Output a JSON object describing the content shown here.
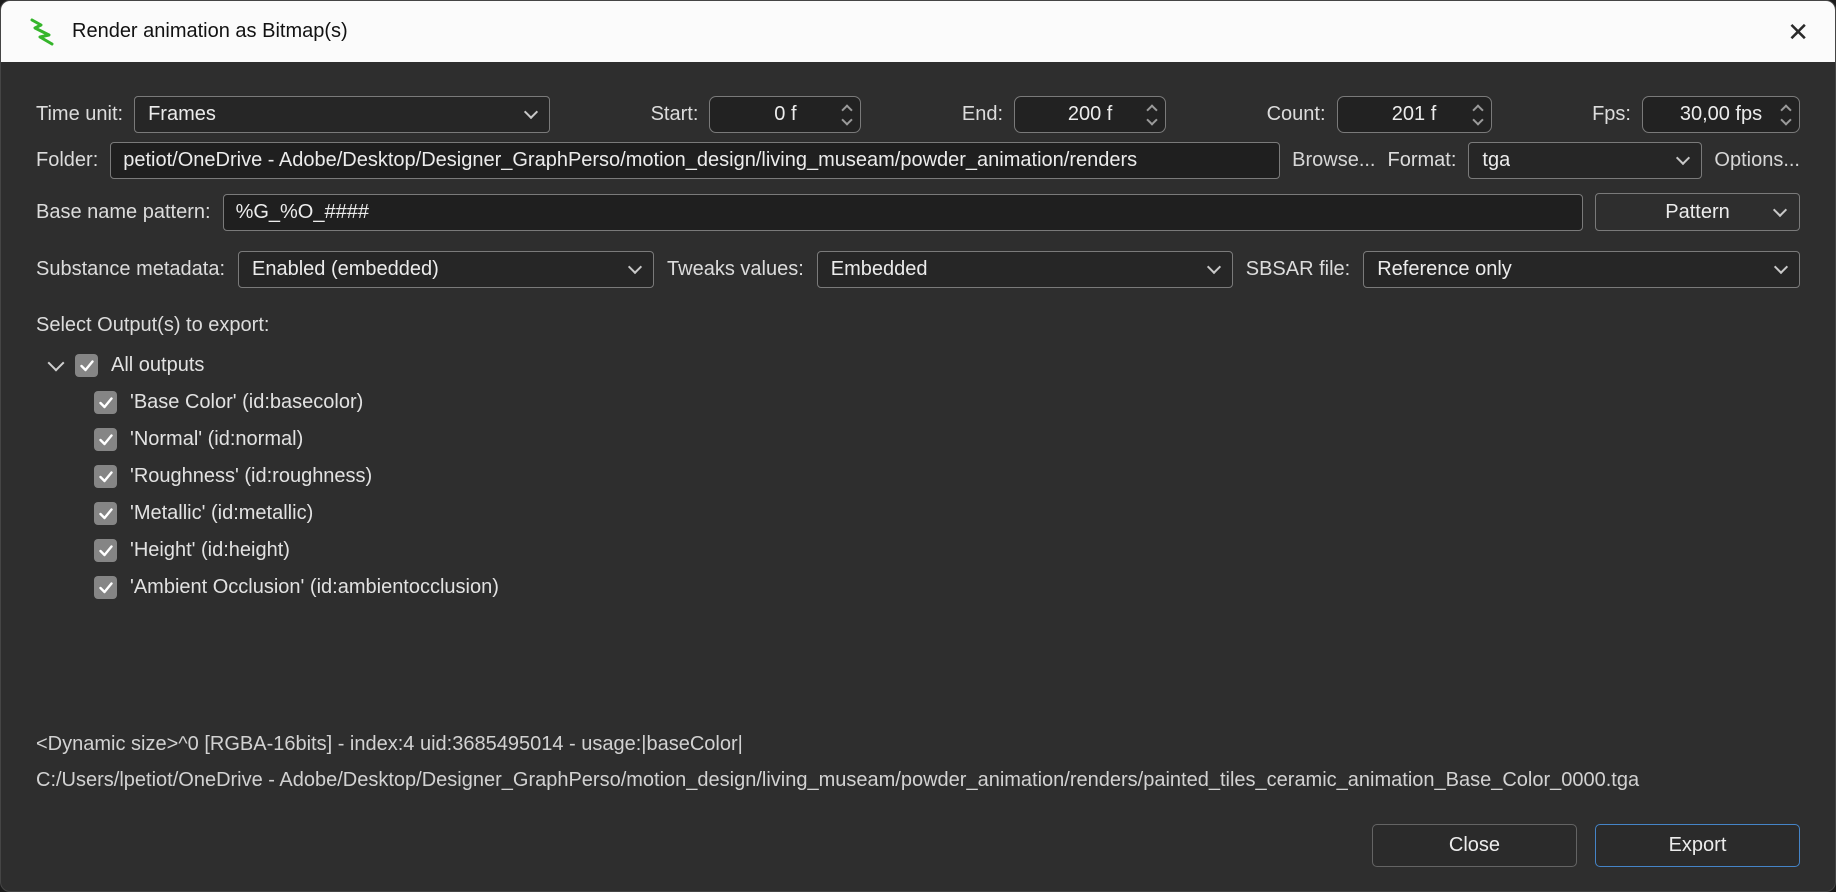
{
  "window": {
    "title": "Render animation as Bitmap(s)",
    "close_glyph": "✕"
  },
  "row1": {
    "time_unit_label": "Time unit:",
    "time_unit_value": "Frames",
    "start_label": "Start:",
    "start_value": "0 f",
    "end_label": "End:",
    "end_value": "200 f",
    "count_label": "Count:",
    "count_value": "201 f",
    "fps_label": "Fps:",
    "fps_value": "30,00 fps"
  },
  "row2": {
    "folder_label": "Folder:",
    "folder_value": "petiot/OneDrive - Adobe/Desktop/Designer_GraphPerso/motion_design/living_museam/powder_animation/renders",
    "browse_label": "Browse...",
    "format_label": "Format:",
    "format_value": "tga",
    "options_label": "Options..."
  },
  "row3": {
    "base_name_label": "Base name pattern:",
    "base_name_value": "%G_%O_####",
    "pattern_button_label": "Pattern"
  },
  "row4": {
    "metadata_label": "Substance metadata:",
    "metadata_value": "Enabled (embedded)",
    "tweaks_label": "Tweaks values:",
    "tweaks_value": "Embedded",
    "sbsar_label": "SBSAR file:",
    "sbsar_value": "Reference only"
  },
  "outputs": {
    "section_label": "Select Output(s) to export:",
    "root_label": "All outputs",
    "items": [
      "'Base Color' (id:basecolor)",
      "'Normal' (id:normal)",
      "'Roughness' (id:roughness)",
      "'Metallic' (id:metallic)",
      "'Height' (id:height)",
      "'Ambient Occlusion' (id:ambientocclusion)"
    ]
  },
  "info": {
    "line1": "<Dynamic size>^0 [RGBA-16bits] - index:4 uid:3685495014 - usage:|baseColor|",
    "line2": "C:/Users/lpetiot/OneDrive - Adobe/Desktop/Designer_GraphPerso/motion_design/living_museam/powder_animation/renders/painted_tiles_ceramic_animation_Base_Color_0000.tga"
  },
  "footer": {
    "close_label": "Close",
    "export_label": "Export"
  },
  "colors": {
    "titlebar_bg": "#fbfbfb",
    "body_bg": "#2e2e2e",
    "control_border": "#7a7a7a",
    "accent_blue": "#4584c7",
    "app_icon_green": "#35b52b",
    "checkbox_gray": "#858585"
  }
}
